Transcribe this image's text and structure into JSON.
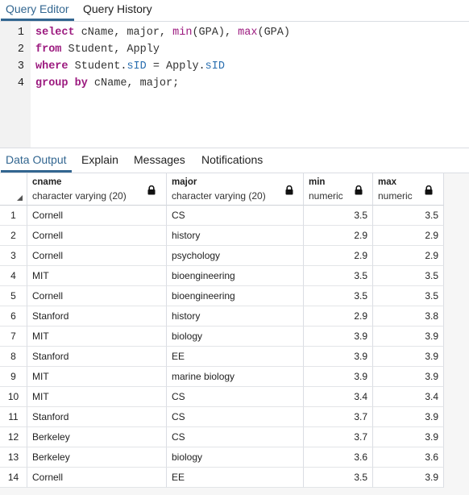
{
  "top_tabs": [
    {
      "label": "Query Editor",
      "active": true
    },
    {
      "label": "Query History",
      "active": false
    }
  ],
  "editor": {
    "lines": [
      {
        "num": "1",
        "tokens": [
          {
            "t": "select",
            "c": "kw"
          },
          {
            "t": " cName, major, ",
            "c": ""
          },
          {
            "t": "min",
            "c": "fn"
          },
          {
            "t": "(GPA), ",
            "c": ""
          },
          {
            "t": "max",
            "c": "fn"
          },
          {
            "t": "(GPA)",
            "c": ""
          }
        ]
      },
      {
        "num": "2",
        "tokens": [
          {
            "t": "from",
            "c": "kw"
          },
          {
            "t": " Student, Apply",
            "c": ""
          }
        ]
      },
      {
        "num": "3",
        "tokens": [
          {
            "t": "where",
            "c": "kw"
          },
          {
            "t": " Student.",
            "c": ""
          },
          {
            "t": "sID",
            "c": "at"
          },
          {
            "t": " = Apply.",
            "c": ""
          },
          {
            "t": "sID",
            "c": "at"
          }
        ]
      },
      {
        "num": "4",
        "tokens": [
          {
            "t": "group by",
            "c": "kw"
          },
          {
            "t": " cName, major;",
            "c": ""
          }
        ]
      }
    ]
  },
  "output_tabs": [
    {
      "label": "Data Output",
      "active": true
    },
    {
      "label": "Explain",
      "active": false
    },
    {
      "label": "Messages",
      "active": false
    },
    {
      "label": "Notifications",
      "active": false
    }
  ],
  "grid": {
    "columns": [
      {
        "name": "cname",
        "type": "character varying (20)",
        "icon": "lock-icon"
      },
      {
        "name": "major",
        "type": "character varying (20)",
        "icon": "lock-icon"
      },
      {
        "name": "min",
        "type": "numeric",
        "icon": "lock-icon"
      },
      {
        "name": "max",
        "type": "numeric",
        "icon": "lock-icon"
      }
    ],
    "rows": [
      {
        "n": "1",
        "cname": "Cornell",
        "major": "CS",
        "min": "3.5",
        "max": "3.5"
      },
      {
        "n": "2",
        "cname": "Cornell",
        "major": "history",
        "min": "2.9",
        "max": "2.9"
      },
      {
        "n": "3",
        "cname": "Cornell",
        "major": "psychology",
        "min": "2.9",
        "max": "2.9"
      },
      {
        "n": "4",
        "cname": "MIT",
        "major": "bioengineering",
        "min": "3.5",
        "max": "3.5"
      },
      {
        "n": "5",
        "cname": "Cornell",
        "major": "bioengineering",
        "min": "3.5",
        "max": "3.5"
      },
      {
        "n": "6",
        "cname": "Stanford",
        "major": "history",
        "min": "2.9",
        "max": "3.8"
      },
      {
        "n": "7",
        "cname": "MIT",
        "major": "biology",
        "min": "3.9",
        "max": "3.9"
      },
      {
        "n": "8",
        "cname": "Stanford",
        "major": "EE",
        "min": "3.9",
        "max": "3.9"
      },
      {
        "n": "9",
        "cname": "MIT",
        "major": "marine biology",
        "min": "3.9",
        "max": "3.9"
      },
      {
        "n": "10",
        "cname": "MIT",
        "major": "CS",
        "min": "3.4",
        "max": "3.4"
      },
      {
        "n": "11",
        "cname": "Stanford",
        "major": "CS",
        "min": "3.7",
        "max": "3.9"
      },
      {
        "n": "12",
        "cname": "Berkeley",
        "major": "CS",
        "min": "3.7",
        "max": "3.9"
      },
      {
        "n": "13",
        "cname": "Berkeley",
        "major": "biology",
        "min": "3.6",
        "max": "3.6"
      },
      {
        "n": "14",
        "cname": "Cornell",
        "major": "EE",
        "min": "3.5",
        "max": "3.9"
      }
    ]
  },
  "colors": {
    "accent": "#326690",
    "keyword": "#9c1a7f",
    "attribute": "#2a6fb0"
  }
}
